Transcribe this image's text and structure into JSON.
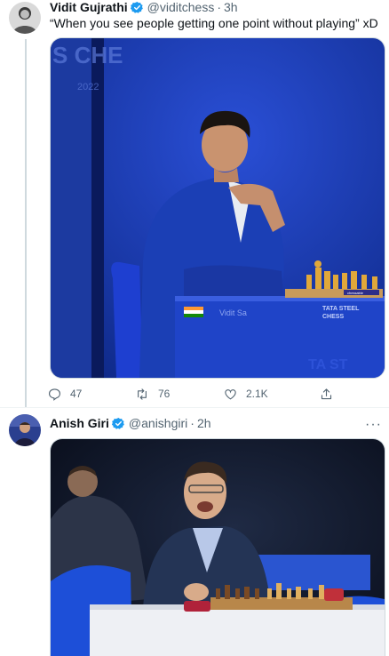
{
  "tweets": [
    {
      "name": "Vidit Gujrathi",
      "handle": "@viditchess",
      "dot": "·",
      "time": "3h",
      "text": "“When you see people getting one point without playing” xD",
      "image_text": {
        "backdrop": "S CHE",
        "year": "2022",
        "placard": "Vidit Sa",
        "sponsor_line1": "TATA STEEL",
        "sponsor_line2": "CHESS",
        "chessable": "chessable",
        "lower_backdrop": "TA ST"
      },
      "stats": {
        "replies": "47",
        "retweets": "76",
        "likes": "2.1K"
      }
    },
    {
      "name": "Anish Giri",
      "handle": "@anishgiri",
      "dot": "·",
      "time": "2h"
    }
  ],
  "more_icon": "···",
  "icons": [
    "verified-badge-icon",
    "more-icon",
    "reply-icon",
    "retweet-icon",
    "like-icon",
    "share-icon"
  ],
  "colors": {
    "verified": "#1d9bf0",
    "text_secondary": "#536471",
    "border": "#cfd9de",
    "backdrop_blue": "#1a3aa8"
  }
}
